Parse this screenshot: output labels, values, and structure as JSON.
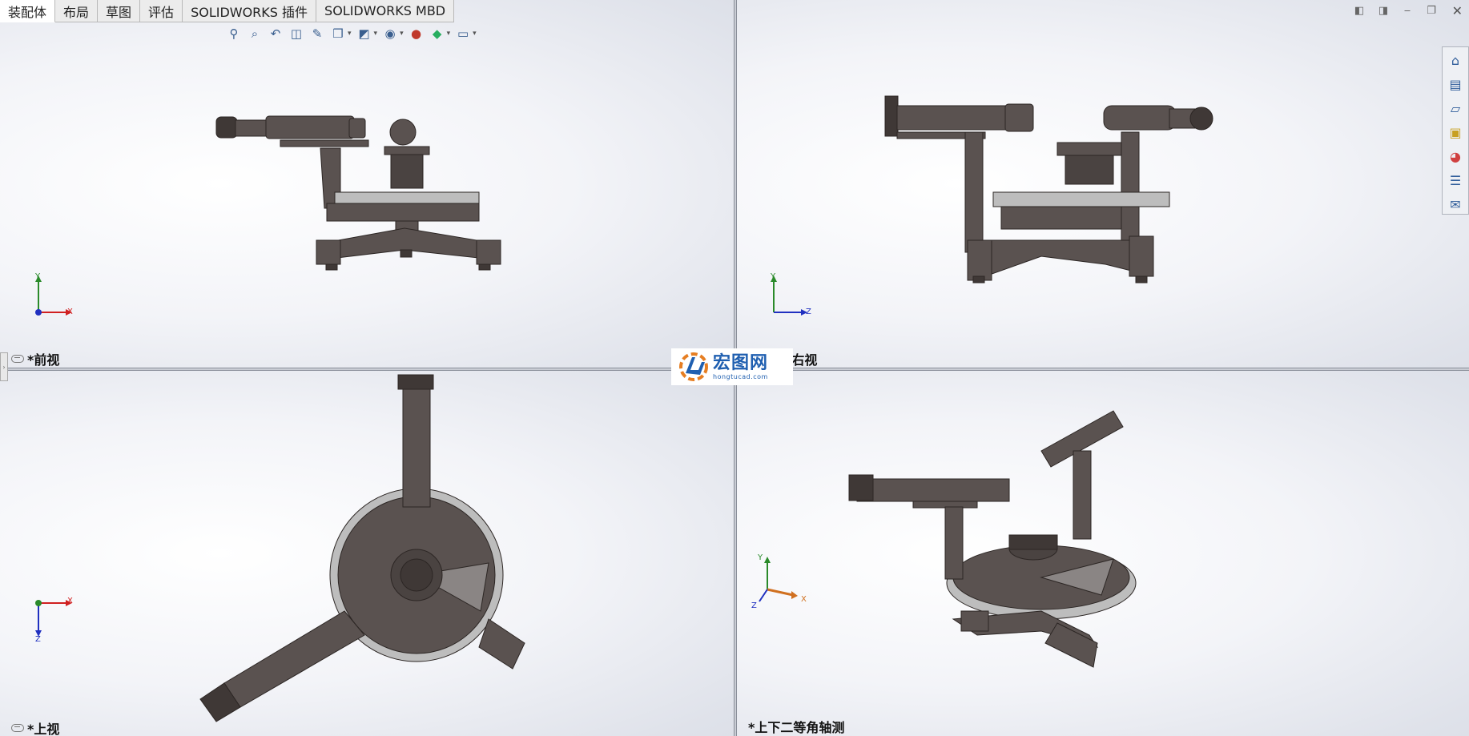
{
  "tabs": [
    {
      "label": "装配体",
      "active": true
    },
    {
      "label": "布局"
    },
    {
      "label": "草图"
    },
    {
      "label": "评估"
    },
    {
      "label": "SOLIDWORKS 插件"
    },
    {
      "label": "SOLIDWORKS MBD"
    }
  ],
  "viewports": {
    "top_left": {
      "label": "*前视",
      "axis_h": "X",
      "axis_v": "Y"
    },
    "top_right": {
      "label": "*右视",
      "axis_h": "Z",
      "axis_v": "Y"
    },
    "bottom_left": {
      "label": "*上视",
      "axis_h": "X",
      "axis_v": "Z"
    },
    "bottom_right": {
      "label": "*上下二等角轴测",
      "axis_h": "X",
      "axis_v": "Y",
      "axis_d": "Z"
    }
  },
  "logo": {
    "name": "宏图网",
    "url": "hongtucad.com"
  },
  "heads_up_toolbar": [
    "zoom-to-fit-icon",
    "zoom-to-area-icon",
    "previous-view-icon",
    "section-view-icon",
    "dynamic-annotation-icon",
    "view-orientation-icon",
    "display-style-icon",
    "hide-show-items-icon",
    "edit-appearance-icon",
    "apply-scene-icon",
    "view-settings-icon"
  ],
  "task_pane": [
    "home-icon",
    "resources-icon",
    "design-library-icon",
    "file-explorer-icon",
    "appearances-icon",
    "custom-properties-icon",
    "forum-icon"
  ],
  "colors": {
    "model": "#5a5250",
    "model_dark": "#3f3836",
    "model_light": "#bdbdbd",
    "axis_x": "#d02020",
    "axis_y": "#2a8a2a",
    "axis_z": "#2030c0",
    "accent": "#1f5fb0"
  }
}
